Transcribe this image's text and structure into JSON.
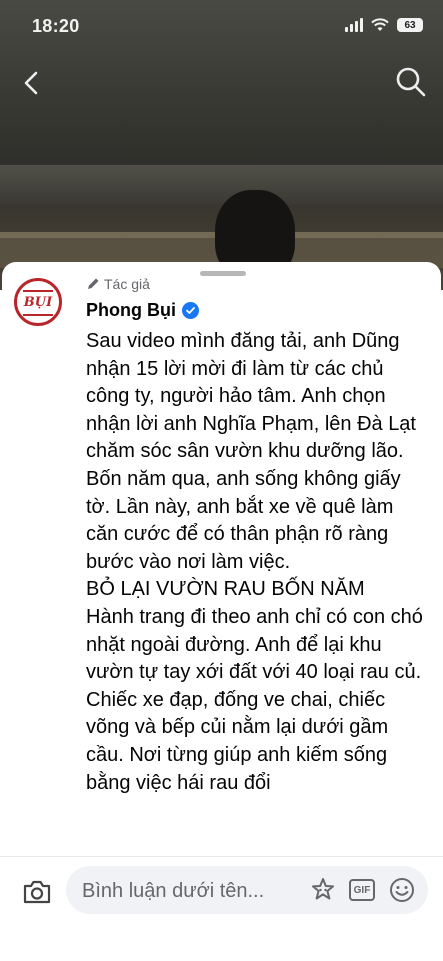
{
  "status_bar": {
    "time": "18:20",
    "battery": "63"
  },
  "nav": {
    "back_icon": "chevron-left-icon",
    "search_icon": "search-icon"
  },
  "comment": {
    "author_tag": "Tác giả",
    "author_name": "Phong Bụi",
    "avatar_logo_text": "BỤI",
    "paragraphs": [
      "Sau video mình đăng tải, anh Dũng nhận 15 lời mời đi làm từ các chủ công ty, người hảo tâm. Anh chọn nhận lời anh Nghĩa Phạm, lên Đà Lạt chăm sóc sân vườn khu dưỡng lão.",
      "Bốn năm qua, anh sống không giấy tờ. Lần này, anh bắt xe về quê làm căn cước để có thân phận rõ ràng bước vào nơi làm việc.",
      "BỎ LẠI VƯỜN RAU BỐN NĂM",
      "Hành trang đi theo anh chỉ có con chó nhặt ngoài đường. Anh để lại khu vườn tự tay xới đất với 40 loại rau củ.",
      "Chiếc xe đạp, đống ve chai, chiếc võng và bếp củi nằm lại dưới gầm cầu. Nơi từng giúp anh kiếm sống bằng việc hái rau đổi"
    ]
  },
  "composer": {
    "placeholder": "Bình luận dưới tên...",
    "gif_label": "GIF"
  },
  "colors": {
    "accent": "#1877f2",
    "brand_red": "#b8262a"
  }
}
